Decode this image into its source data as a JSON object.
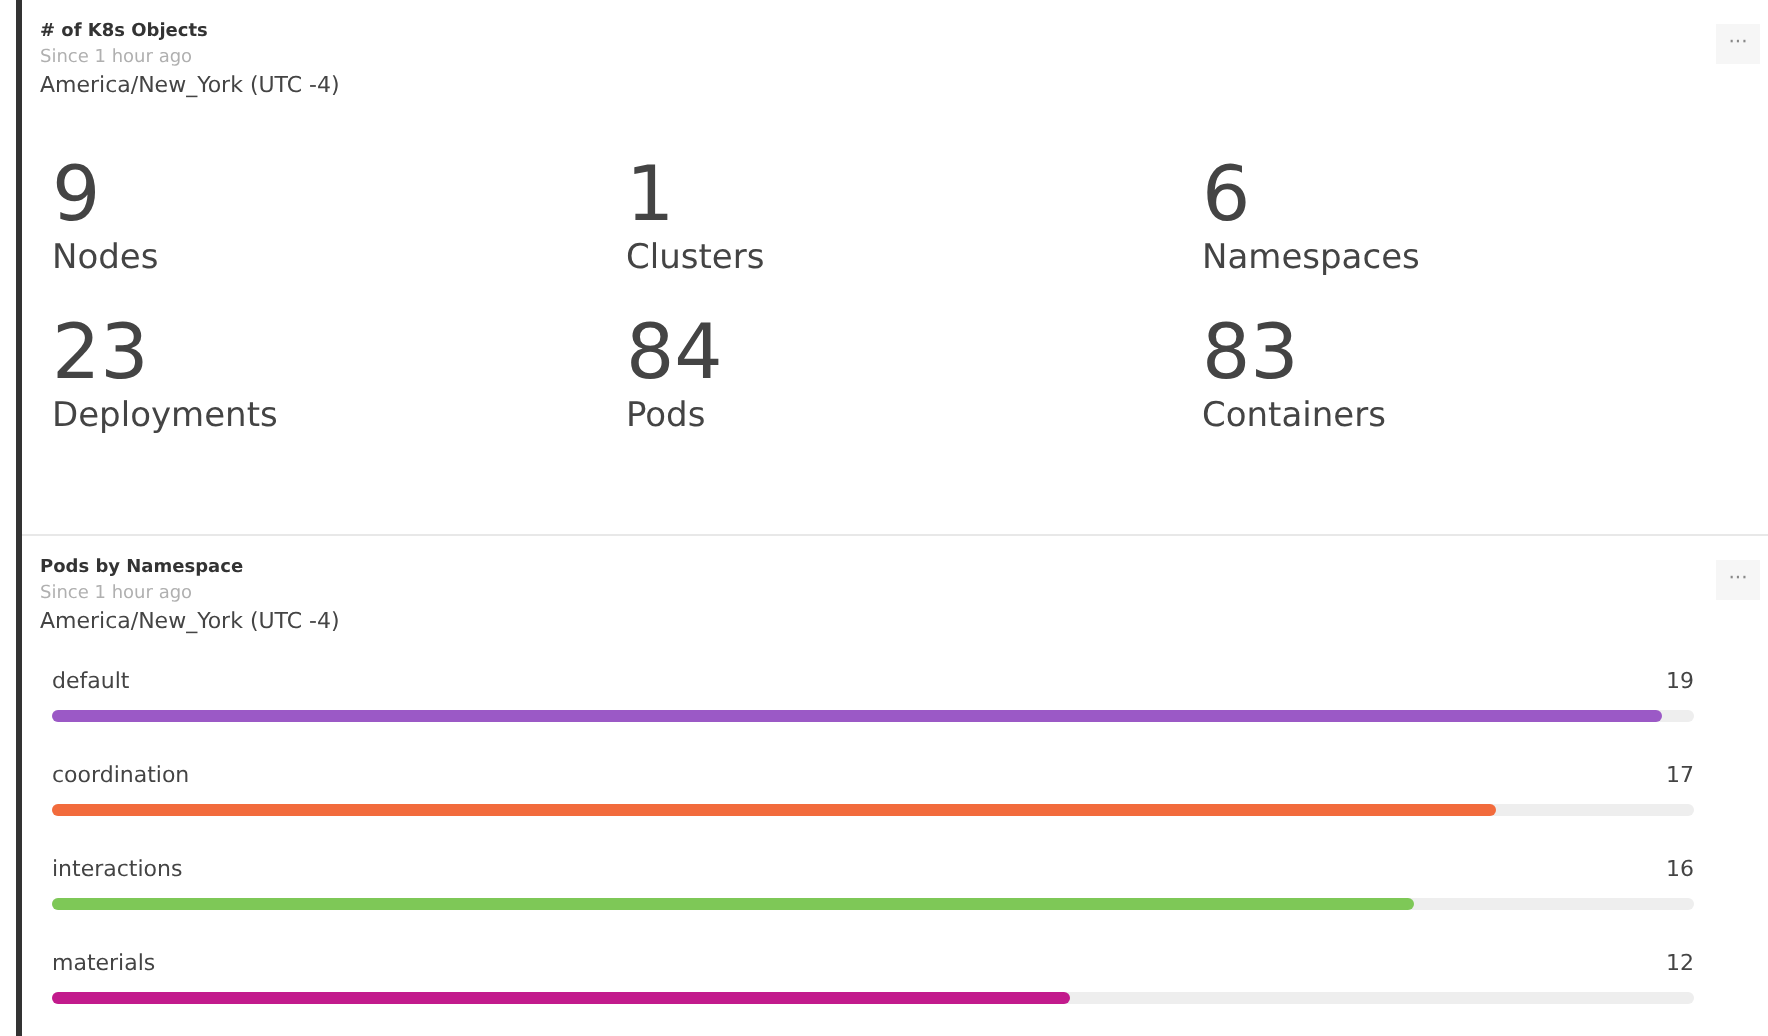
{
  "panels": [
    {
      "kind": "stats",
      "title": "# of K8s Objects",
      "since": "Since 1 hour ago",
      "timezone": "America/New_York (UTC -4)",
      "menu": "···",
      "stats": [
        {
          "value": "9",
          "label": "Nodes"
        },
        {
          "value": "1",
          "label": "Clusters"
        },
        {
          "value": "6",
          "label": "Namespaces"
        },
        {
          "value": "23",
          "label": "Deployments"
        },
        {
          "value": "84",
          "label": "Pods"
        },
        {
          "value": "83",
          "label": "Containers"
        }
      ]
    },
    {
      "kind": "bars",
      "title": "Pods by Namespace",
      "since": "Since 1 hour ago",
      "timezone": "America/New_York (UTC -4)",
      "menu": "···",
      "bars": [
        {
          "label": "default",
          "count": "19",
          "level": 0.98,
          "color": "#9b59c6"
        },
        {
          "label": "coordination",
          "count": "17",
          "level": 0.88,
          "color": "#f26b3c"
        },
        {
          "label": "interactions",
          "count": "16",
          "level": 0.83,
          "color": "#7ec857"
        },
        {
          "label": "materials",
          "count": "12",
          "level": 0.62,
          "color": "#c21a8c"
        }
      ]
    }
  ]
}
